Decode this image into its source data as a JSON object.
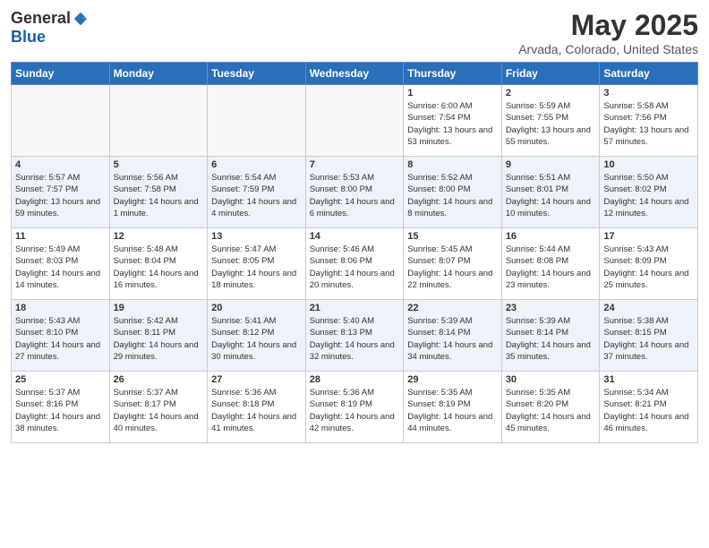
{
  "header": {
    "logo_general": "General",
    "logo_blue": "Blue",
    "main_title": "May 2025",
    "subtitle": "Arvada, Colorado, United States"
  },
  "calendar": {
    "days_of_week": [
      "Sunday",
      "Monday",
      "Tuesday",
      "Wednesday",
      "Thursday",
      "Friday",
      "Saturday"
    ],
    "weeks": [
      {
        "days": [
          {
            "num": "",
            "empty": true
          },
          {
            "num": "",
            "empty": true
          },
          {
            "num": "",
            "empty": true
          },
          {
            "num": "",
            "empty": true
          },
          {
            "num": "1",
            "sunrise": "Sunrise: 6:00 AM",
            "sunset": "Sunset: 7:54 PM",
            "daylight": "Daylight: 13 hours and 53 minutes."
          },
          {
            "num": "2",
            "sunrise": "Sunrise: 5:59 AM",
            "sunset": "Sunset: 7:55 PM",
            "daylight": "Daylight: 13 hours and 55 minutes."
          },
          {
            "num": "3",
            "sunrise": "Sunrise: 5:58 AM",
            "sunset": "Sunset: 7:56 PM",
            "daylight": "Daylight: 13 hours and 57 minutes."
          }
        ]
      },
      {
        "days": [
          {
            "num": "4",
            "sunrise": "Sunrise: 5:57 AM",
            "sunset": "Sunset: 7:57 PM",
            "daylight": "Daylight: 13 hours and 59 minutes."
          },
          {
            "num": "5",
            "sunrise": "Sunrise: 5:56 AM",
            "sunset": "Sunset: 7:58 PM",
            "daylight": "Daylight: 14 hours and 1 minute."
          },
          {
            "num": "6",
            "sunrise": "Sunrise: 5:54 AM",
            "sunset": "Sunset: 7:59 PM",
            "daylight": "Daylight: 14 hours and 4 minutes."
          },
          {
            "num": "7",
            "sunrise": "Sunrise: 5:53 AM",
            "sunset": "Sunset: 8:00 PM",
            "daylight": "Daylight: 14 hours and 6 minutes."
          },
          {
            "num": "8",
            "sunrise": "Sunrise: 5:52 AM",
            "sunset": "Sunset: 8:00 PM",
            "daylight": "Daylight: 14 hours and 8 minutes."
          },
          {
            "num": "9",
            "sunrise": "Sunrise: 5:51 AM",
            "sunset": "Sunset: 8:01 PM",
            "daylight": "Daylight: 14 hours and 10 minutes."
          },
          {
            "num": "10",
            "sunrise": "Sunrise: 5:50 AM",
            "sunset": "Sunset: 8:02 PM",
            "daylight": "Daylight: 14 hours and 12 minutes."
          }
        ]
      },
      {
        "days": [
          {
            "num": "11",
            "sunrise": "Sunrise: 5:49 AM",
            "sunset": "Sunset: 8:03 PM",
            "daylight": "Daylight: 14 hours and 14 minutes."
          },
          {
            "num": "12",
            "sunrise": "Sunrise: 5:48 AM",
            "sunset": "Sunset: 8:04 PM",
            "daylight": "Daylight: 14 hours and 16 minutes."
          },
          {
            "num": "13",
            "sunrise": "Sunrise: 5:47 AM",
            "sunset": "Sunset: 8:05 PM",
            "daylight": "Daylight: 14 hours and 18 minutes."
          },
          {
            "num": "14",
            "sunrise": "Sunrise: 5:46 AM",
            "sunset": "Sunset: 8:06 PM",
            "daylight": "Daylight: 14 hours and 20 minutes."
          },
          {
            "num": "15",
            "sunrise": "Sunrise: 5:45 AM",
            "sunset": "Sunset: 8:07 PM",
            "daylight": "Daylight: 14 hours and 22 minutes."
          },
          {
            "num": "16",
            "sunrise": "Sunrise: 5:44 AM",
            "sunset": "Sunset: 8:08 PM",
            "daylight": "Daylight: 14 hours and 23 minutes."
          },
          {
            "num": "17",
            "sunrise": "Sunrise: 5:43 AM",
            "sunset": "Sunset: 8:09 PM",
            "daylight": "Daylight: 14 hours and 25 minutes."
          }
        ]
      },
      {
        "days": [
          {
            "num": "18",
            "sunrise": "Sunrise: 5:43 AM",
            "sunset": "Sunset: 8:10 PM",
            "daylight": "Daylight: 14 hours and 27 minutes."
          },
          {
            "num": "19",
            "sunrise": "Sunrise: 5:42 AM",
            "sunset": "Sunset: 8:11 PM",
            "daylight": "Daylight: 14 hours and 29 minutes."
          },
          {
            "num": "20",
            "sunrise": "Sunrise: 5:41 AM",
            "sunset": "Sunset: 8:12 PM",
            "daylight": "Daylight: 14 hours and 30 minutes."
          },
          {
            "num": "21",
            "sunrise": "Sunrise: 5:40 AM",
            "sunset": "Sunset: 8:13 PM",
            "daylight": "Daylight: 14 hours and 32 minutes."
          },
          {
            "num": "22",
            "sunrise": "Sunrise: 5:39 AM",
            "sunset": "Sunset: 8:14 PM",
            "daylight": "Daylight: 14 hours and 34 minutes."
          },
          {
            "num": "23",
            "sunrise": "Sunrise: 5:39 AM",
            "sunset": "Sunset: 8:14 PM",
            "daylight": "Daylight: 14 hours and 35 minutes."
          },
          {
            "num": "24",
            "sunrise": "Sunrise: 5:38 AM",
            "sunset": "Sunset: 8:15 PM",
            "daylight": "Daylight: 14 hours and 37 minutes."
          }
        ]
      },
      {
        "days": [
          {
            "num": "25",
            "sunrise": "Sunrise: 5:37 AM",
            "sunset": "Sunset: 8:16 PM",
            "daylight": "Daylight: 14 hours and 38 minutes."
          },
          {
            "num": "26",
            "sunrise": "Sunrise: 5:37 AM",
            "sunset": "Sunset: 8:17 PM",
            "daylight": "Daylight: 14 hours and 40 minutes."
          },
          {
            "num": "27",
            "sunrise": "Sunrise: 5:36 AM",
            "sunset": "Sunset: 8:18 PM",
            "daylight": "Daylight: 14 hours and 41 minutes."
          },
          {
            "num": "28",
            "sunrise": "Sunrise: 5:36 AM",
            "sunset": "Sunset: 8:19 PM",
            "daylight": "Daylight: 14 hours and 42 minutes."
          },
          {
            "num": "29",
            "sunrise": "Sunrise: 5:35 AM",
            "sunset": "Sunset: 8:19 PM",
            "daylight": "Daylight: 14 hours and 44 minutes."
          },
          {
            "num": "30",
            "sunrise": "Sunrise: 5:35 AM",
            "sunset": "Sunset: 8:20 PM",
            "daylight": "Daylight: 14 hours and 45 minutes."
          },
          {
            "num": "31",
            "sunrise": "Sunrise: 5:34 AM",
            "sunset": "Sunset: 8:21 PM",
            "daylight": "Daylight: 14 hours and 46 minutes."
          }
        ]
      }
    ]
  }
}
